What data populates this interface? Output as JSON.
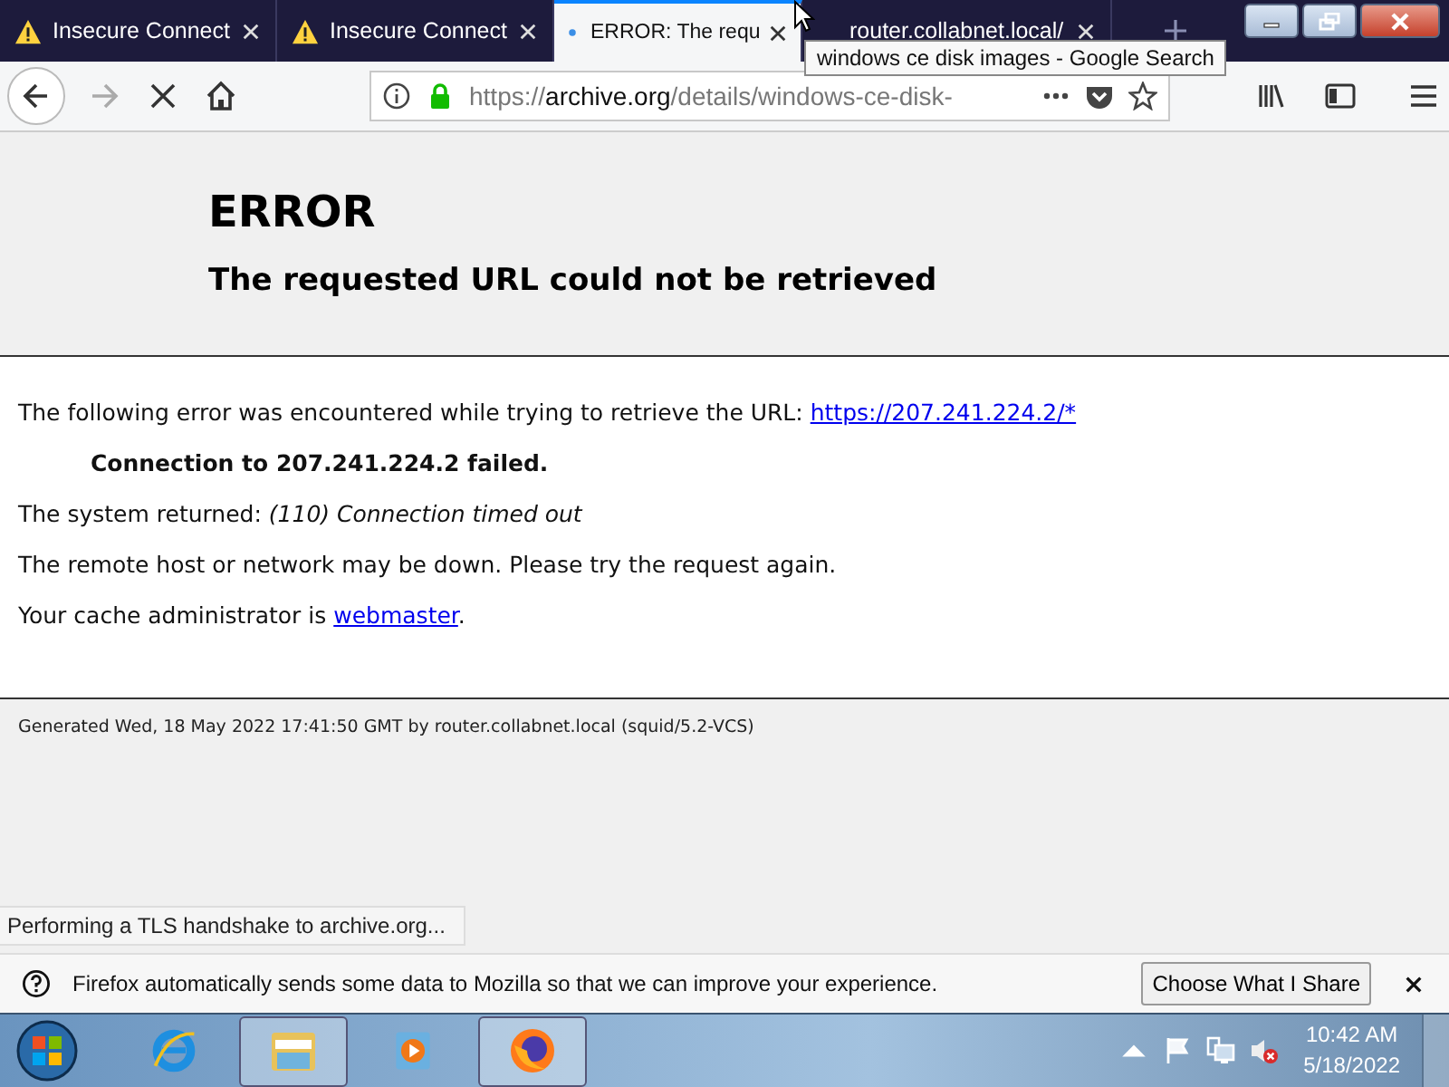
{
  "tabs": [
    {
      "title": "Insecure Connect",
      "kind": "warning",
      "selected": false
    },
    {
      "title": "Insecure Connect",
      "kind": "warning",
      "selected": false
    },
    {
      "title": "ERROR: The requ",
      "kind": "loading",
      "selected": true
    },
    {
      "title": "router.collabnet.local/",
      "kind": "plain",
      "selected": false
    }
  ],
  "tooltip": "windows ce disk images - Google Search",
  "url": {
    "scheme": "https://",
    "host": "archive.org",
    "path": "/details/windows-ce-disk-"
  },
  "page": {
    "title": "ERROR",
    "subtitle": "The requested URL could not be retrieved",
    "lines": [
      {
        "kind": "link",
        "before": "The following error was encountered while trying to retrieve the URL: ",
        "link": "https://207.241.224.2/*"
      },
      {
        "kind": "strong",
        "text": "Connection to 207.241.224.2 failed."
      },
      {
        "kind": "text",
        "text": "The system returned: *(110) Connection timed out*"
      },
      {
        "kind": "text",
        "text": "The remote host or network may be down. Please try the request again."
      },
      {
        "kind": "link",
        "before": "Your cache administrator is ",
        "link": "webmaster",
        "after": "."
      }
    ],
    "footer": "Generated Wed, 18 May 2022 17:41:50 GMT by router.collabnet.local (squid/5.2-VCS)"
  },
  "status": "Performing a TLS handshake to archive.org...",
  "notification": {
    "text": "Firefox automatically sends some data to Mozilla so that we can improve your experience.",
    "button": "Choose What I Share"
  },
  "taskbar": {
    "apps": [
      {
        "active": false
      },
      {
        "active": true
      },
      {
        "active": false
      },
      {
        "active": true
      }
    ],
    "time": "10:42 AM",
    "date": "5/18/2022"
  }
}
